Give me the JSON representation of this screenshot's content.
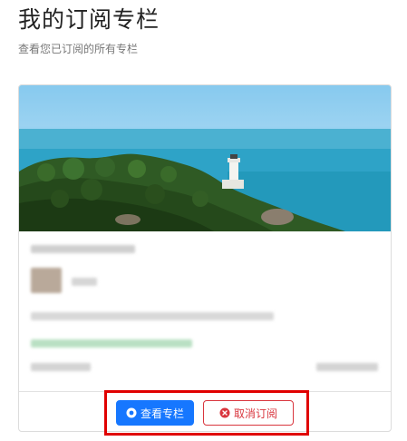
{
  "header": {
    "title": "我的订阅专栏",
    "subtitle": "查看您已订阅的所有专栏"
  },
  "card": {
    "view_button_label": "查看专栏",
    "unsubscribe_button_label": "取消订阅",
    "view_icon": "eye-icon",
    "unsubscribe_icon": "close-circle-icon"
  },
  "colors": {
    "primary": "#1677ff",
    "danger": "#d9363e",
    "highlight": "#e00000"
  }
}
